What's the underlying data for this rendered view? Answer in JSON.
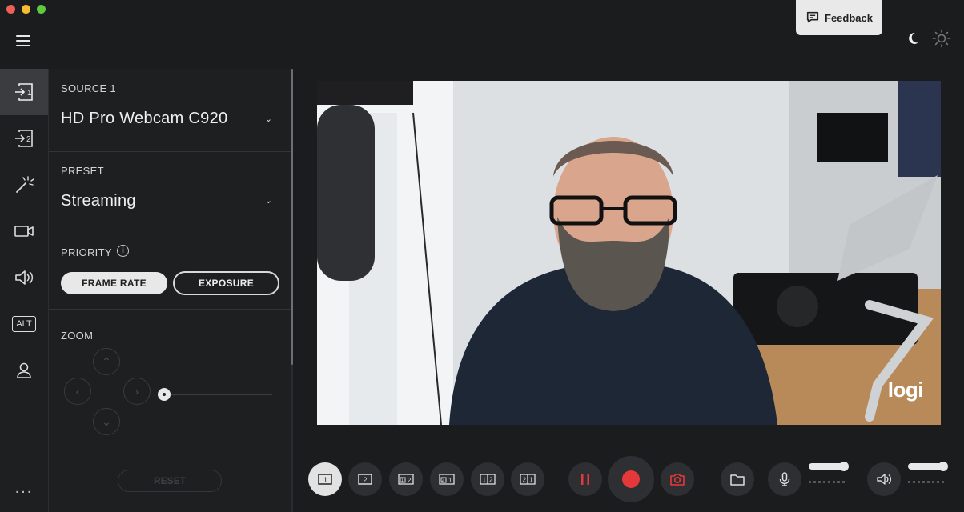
{
  "feedback": {
    "label": "Feedback"
  },
  "sidebar": {
    "items": [
      {
        "name": "source-1",
        "active": true
      },
      {
        "name": "source-2",
        "active": false
      },
      {
        "name": "effects",
        "active": false
      },
      {
        "name": "camera",
        "active": false
      },
      {
        "name": "audio",
        "active": false
      },
      {
        "name": "alt",
        "label": "ALT",
        "active": false
      },
      {
        "name": "account",
        "active": false
      }
    ],
    "more": "..."
  },
  "panel": {
    "source": {
      "title": "SOURCE 1",
      "value": "HD Pro Webcam C920"
    },
    "preset": {
      "title": "PRESET",
      "value": "Streaming"
    },
    "priority": {
      "title": "PRIORITY",
      "info": "i",
      "options": [
        "FRAME RATE",
        "EXPOSURE"
      ],
      "selected": "FRAME RATE"
    },
    "zoom": {
      "title": "ZOOM",
      "reset": "RESET"
    }
  },
  "preview": {
    "watermark": "logi"
  },
  "layouts": [
    {
      "name": "layout-1",
      "labels": [
        "1"
      ],
      "selected": true
    },
    {
      "name": "layout-2",
      "labels": [
        "2"
      ],
      "selected": false
    },
    {
      "name": "layout-1-2-pip",
      "labels": [
        "1",
        "2"
      ],
      "selected": false
    },
    {
      "name": "layout-2-1-pip",
      "labels": [
        "2",
        "1"
      ],
      "selected": false
    },
    {
      "name": "layout-1-2-side",
      "labels": [
        "1",
        "2"
      ],
      "selected": false
    },
    {
      "name": "layout-2-1-side",
      "labels": [
        "2",
        "1"
      ],
      "selected": false
    }
  ],
  "colors": {
    "accent_red": "#e5383b",
    "panel_bg": "#1e1f21",
    "light": "#e8e8e8"
  }
}
